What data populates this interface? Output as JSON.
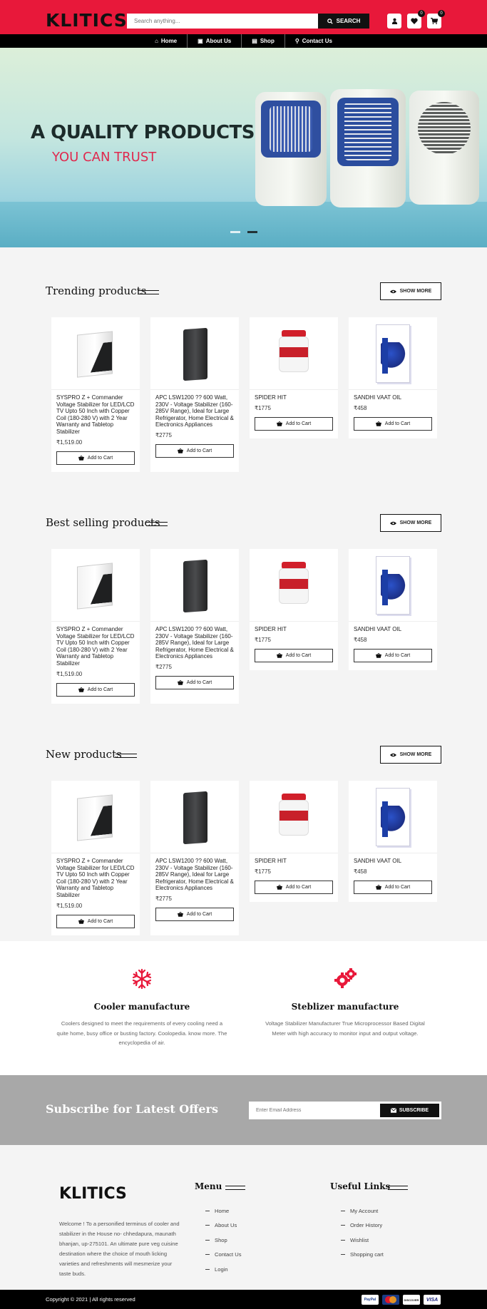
{
  "header": {
    "logo": "KLITICS",
    "search_placeholder": "Search anything...",
    "search_button": "SEARCH",
    "wishlist_count": "0",
    "cart_count": "0"
  },
  "nav": [
    "Home",
    "About Us",
    "Shop",
    "Contact Us"
  ],
  "hero": {
    "title": "A QUALITY PRODUCTS",
    "subtitle": "YOU CAN TRUST"
  },
  "sections": [
    {
      "title": "Trending products",
      "show_more": "SHOW MORE"
    },
    {
      "title": "Best selling products",
      "show_more": "SHOW MORE"
    },
    {
      "title": "New products",
      "show_more": "SHOW MORE"
    }
  ],
  "products": [
    {
      "name": "SYSPRO Z + Commander Voltage Stabilizer for LED/LCD TV Upto 50 Inch with Copper Coil (180-280 V) with 2 Year Warranty and Tabletop Stabilizer",
      "price": "₹1,519.00",
      "image": "stabilizer-image"
    },
    {
      "name": "APC LSW1200 ?? 600 Watt, 230V - Voltage Stabilizer (160-285V Range), Ideal for Large Refrigerator, Home Electrical & Electronics Appliances",
      "price": "₹2775",
      "image": "apc-stabilizer-image"
    },
    {
      "name": "SPIDER HIT",
      "price": "₹1775",
      "image": "spider-hit-jar-image"
    },
    {
      "name": "SANDHI VAAT OIL",
      "price": "₹458",
      "image": "sandhi-vaat-box-image"
    }
  ],
  "add_to_cart": "Add to Cart",
  "features": [
    {
      "icon": "snowflake-icon",
      "title": "Cooler manufacture",
      "text": "Coolers designed to meet the requirements of every cooling need a quite home, busy office or busting factory. Coolopedia. know more. The encyclopedia of air."
    },
    {
      "icon": "gears-icon",
      "title": "Steblizer manufacture",
      "text": "Voltage Stabilizer Manufacturer True Microprocessor Based Digital Meter with high accuracy to monitor input and output voltage."
    }
  ],
  "subscribe": {
    "title": "Subscribe for Latest Offers",
    "placeholder": "Enter Email Address",
    "button": "SUBSCRIBE"
  },
  "footer": {
    "logo": "KLITICS",
    "description": "Welcome ! To a personified terminus of cooler and stabilizer in the House no- chhedapura, maunath bhanjan, up-275101. An ultimate pure veg cuisine destination where the choice of mouth licking varieties and refreshments will mesmerize your taste buds.",
    "menu_title": "Menu",
    "menu": [
      "Home",
      "About Us",
      "Shop",
      "Contact Us",
      "Login"
    ],
    "links_title": "Useful Links",
    "links": [
      "My Account",
      "Order History",
      "Wishlist",
      "Shopping cart"
    ],
    "copyright": "Copyright © 2021 | All rights reserved",
    "payments": [
      "PayPal",
      "MasterCard",
      "DISCOVER",
      "VISA"
    ]
  },
  "colors": {
    "brand": "#e8183a",
    "dark": "#000000",
    "accent_text": "#e0284e"
  }
}
